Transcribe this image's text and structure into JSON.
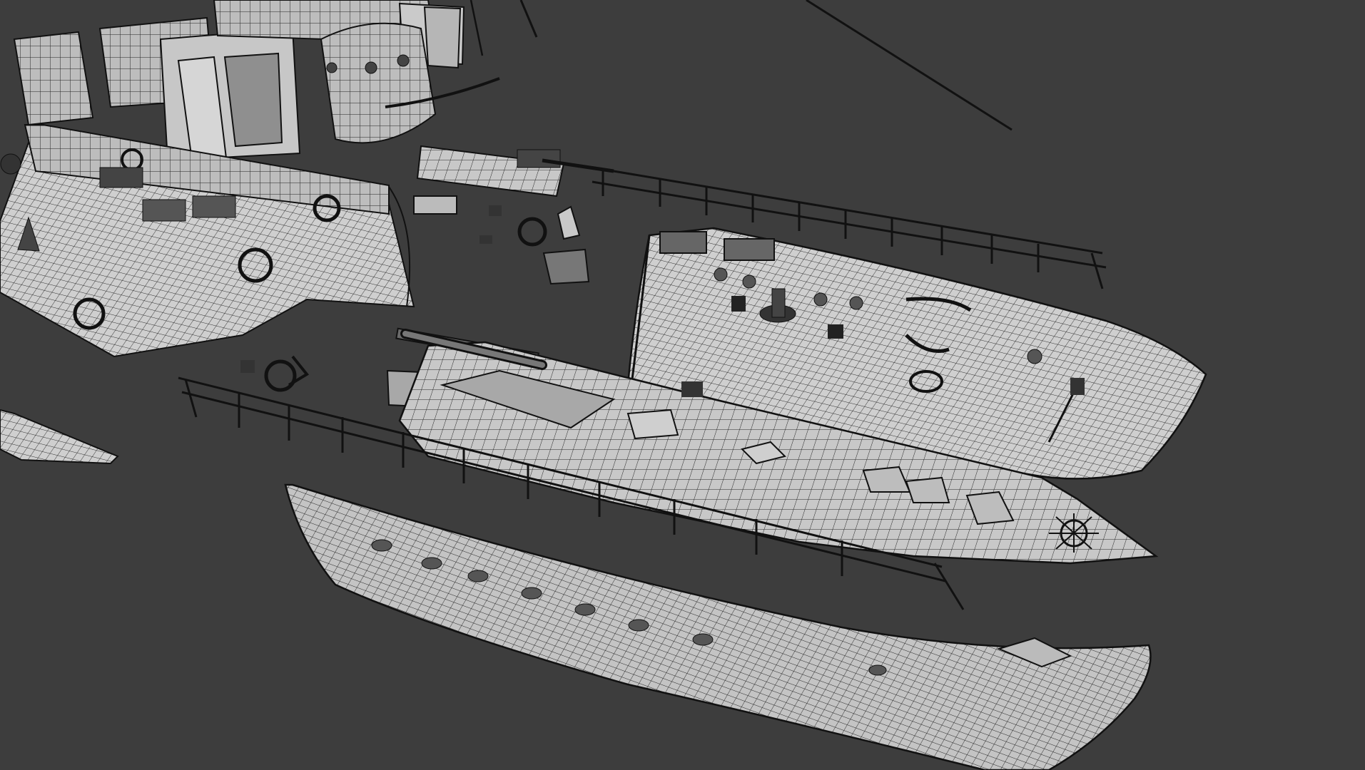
{
  "scene": {
    "background_color": "#3d3d3d",
    "mesh_fill_color": "#c9c9c9",
    "mesh_line_color": "#1e1e1e",
    "parts": [
      "superstructure",
      "funnel",
      "aft-deck",
      "forecastle-deck",
      "main-deck",
      "port-hull-side",
      "stern-fragment",
      "railing-upper",
      "railing-lower",
      "gun-barrel",
      "cable-line"
    ]
  }
}
